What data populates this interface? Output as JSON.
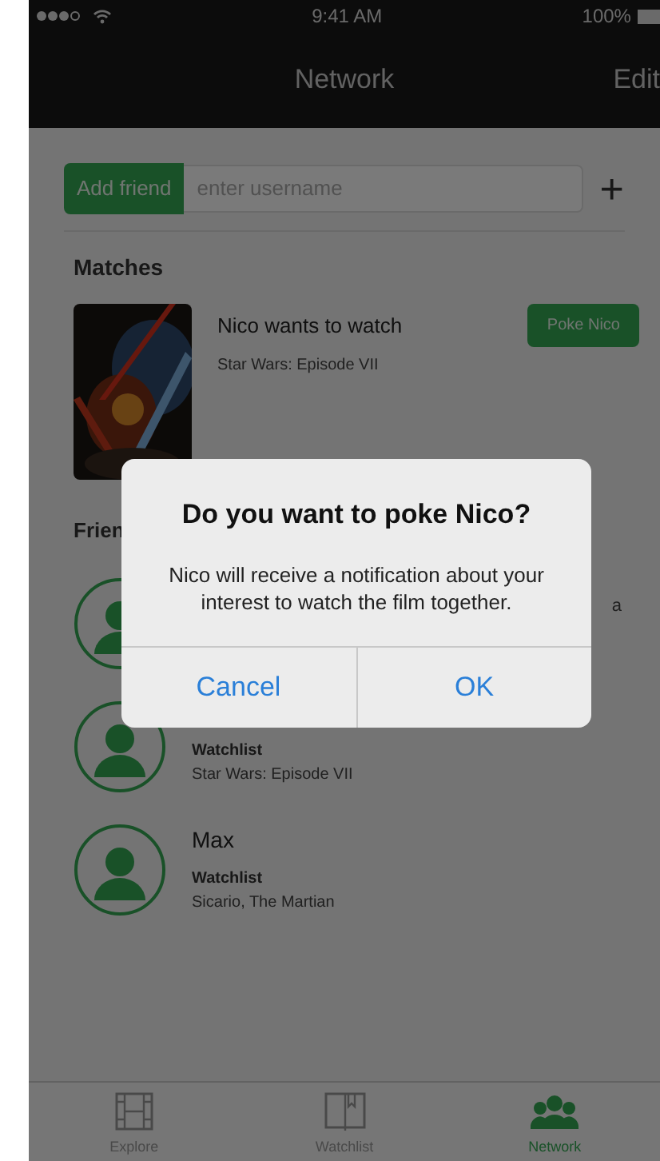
{
  "status_bar": {
    "time": "9:41 AM",
    "battery": "100%"
  },
  "nav": {
    "title": "Network",
    "action": "Edit"
  },
  "add_friend": {
    "button": "Add friend",
    "placeholder": "enter username",
    "add": "+"
  },
  "matches": {
    "title": "Matches",
    "items": [
      {
        "name": "Nico",
        "text": " wants to watch",
        "film": "Star Wars: Episode VII",
        "button": "Poke Nico"
      }
    ]
  },
  "friends": {
    "title": "Frien",
    "items": [
      {
        "trailing_text": "a"
      },
      {
        "watchlist_label": "Watchlist",
        "films": "Star Wars: Episode VII"
      },
      {
        "name": "Max",
        "watchlist_label": "Watchlist",
        "films": "Sicario, The Martian"
      }
    ]
  },
  "tabs": [
    {
      "label": "Explore",
      "kind": "film",
      "selected": false
    },
    {
      "label": "Watchlist",
      "kind": "book",
      "selected": false
    },
    {
      "label": "Network",
      "kind": "people",
      "selected": true
    }
  ],
  "dialog": {
    "title": "Do you want to poke Nico?",
    "message": "Nico will receive a notification about your interest to watch the film together.",
    "buttons": [
      "Cancel",
      "OK"
    ]
  }
}
